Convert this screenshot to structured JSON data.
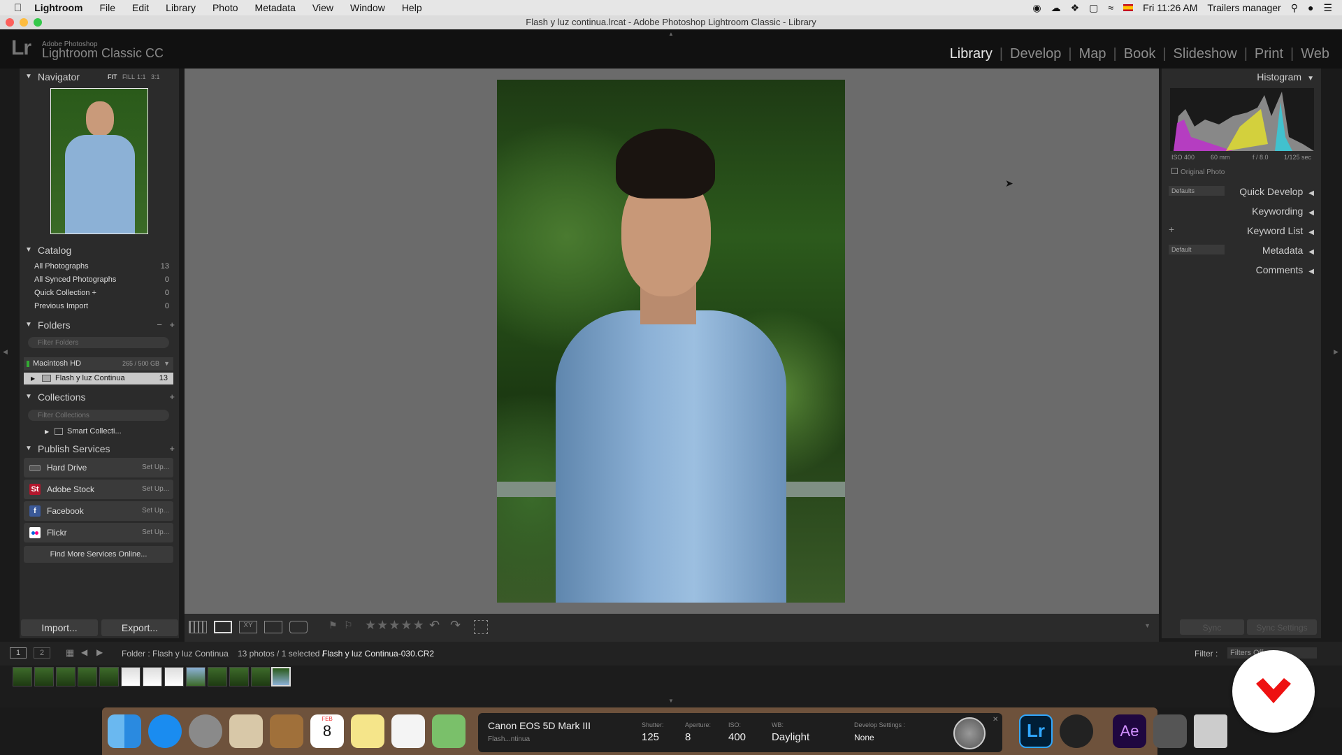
{
  "menubar": {
    "app": "Lightroom",
    "items": [
      "File",
      "Edit",
      "Library",
      "Photo",
      "Metadata",
      "View",
      "Window",
      "Help"
    ],
    "clock": "Fri 11:26 AM",
    "user": "Trailers manager"
  },
  "window_title": "Flash y luz continua.lrcat - Adobe Photoshop Lightroom Classic - Library",
  "lr": {
    "logo": "Lr",
    "small": "Adobe Photoshop",
    "name": "Lightroom Classic CC"
  },
  "modules": [
    "Library",
    "Develop",
    "Map",
    "Book",
    "Slideshow",
    "Print",
    "Web"
  ],
  "active_module": "Library",
  "navigator": {
    "title": "Navigator",
    "zoom_options": [
      "FIT",
      "FILL",
      "1:1",
      "3:1"
    ]
  },
  "catalog": {
    "title": "Catalog",
    "items": [
      {
        "label": "All Photographs",
        "count": "13"
      },
      {
        "label": "All Synced Photographs",
        "count": "0"
      },
      {
        "label": "Quick Collection +",
        "count": "0"
      },
      {
        "label": "Previous Import",
        "count": "0"
      }
    ]
  },
  "folders": {
    "title": "Folders",
    "filter_placeholder": "Filter Folders",
    "volume": "Macintosh HD",
    "volume_size": "265 / 500 GB",
    "folder": "Flash y luz Continua",
    "folder_count": "13"
  },
  "collections": {
    "title": "Collections",
    "filter_placeholder": "Filter Collections",
    "item": "Smart Collecti..."
  },
  "publish": {
    "title": "Publish Services",
    "services": [
      {
        "label": "Hard Drive",
        "action": "Set Up...",
        "icon": "hard-drive-icon",
        "color": "#555555",
        "glyph": ""
      },
      {
        "label": "Adobe Stock",
        "action": "Set Up...",
        "icon": "adobe-stock-icon",
        "color": "#b3172d",
        "glyph": "St"
      },
      {
        "label": "Facebook",
        "action": "Set Up...",
        "icon": "facebook-icon",
        "color": "#3b5998",
        "glyph": "f"
      },
      {
        "label": "Flickr",
        "action": "Set Up...",
        "icon": "flickr-icon",
        "color": "#ffffff",
        "glyph": ""
      }
    ],
    "find_more": "Find More Services Online..."
  },
  "buttons": {
    "import": "Import...",
    "export": "Export..."
  },
  "histogram": {
    "title": "Histogram",
    "iso": "ISO 400",
    "focal": "60 mm",
    "aperture": "f / 8.0",
    "shutter": "1/125 sec",
    "original_photo": "Original Photo"
  },
  "right_panels": {
    "quick_develop": "Quick Develop",
    "defaults": "Defaults",
    "keywording": "Keywording",
    "keyword_list": "Keyword List",
    "metadata": "Metadata",
    "default": "Default",
    "comments": "Comments",
    "sync": "Sync",
    "sync_settings": "Sync Settings"
  },
  "filmstrip": {
    "page1": "1",
    "page2": "2",
    "source": "Folder : Flash y luz Continua",
    "count": "13 photos / 1 selected /",
    "filename": "Flash y luz Continua-030.CR2",
    "filter_label": "Filter :",
    "filter_value": "Filters Off"
  },
  "camera_hud": {
    "model": "Canon EOS 5D Mark III",
    "session": "Flash...ntinua",
    "shutter_label": "Shutter:",
    "shutter": "125",
    "aperture_label": "Aperture:",
    "aperture": "8",
    "iso_label": "ISO:",
    "iso": "400",
    "wb_label": "WB:",
    "wb": "Daylight",
    "dev_label": "Develop Settings :",
    "dev": "None"
  },
  "dock_calendar": {
    "month": "FEB",
    "day": "8"
  }
}
